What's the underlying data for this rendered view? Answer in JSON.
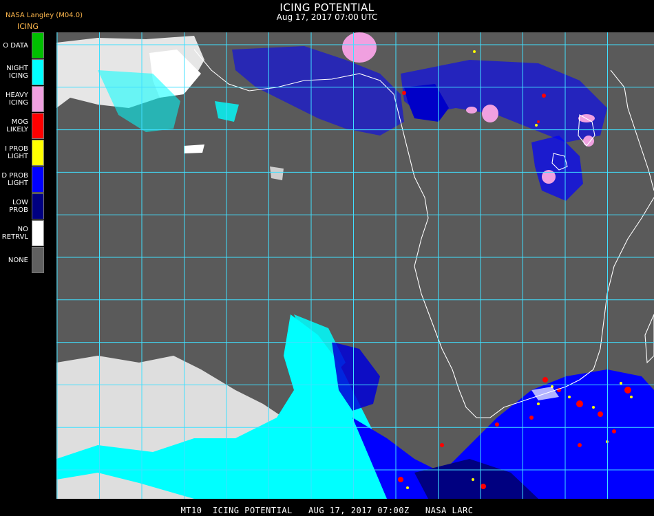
{
  "header": {
    "title": "ICING POTENTIAL",
    "datetime": "Aug 17, 2017 07:00 UTC"
  },
  "product_id": "NASA Langley (M04.0)",
  "legend": {
    "title": "ICING",
    "items": [
      {
        "label_lines": [
          "O DATA"
        ],
        "color": "#00c000"
      },
      {
        "label_lines": [
          "NIGHT",
          "ICING"
        ],
        "color": "#00ffff"
      },
      {
        "label_lines": [
          "HEAVY",
          "ICING"
        ],
        "color": "#f0a0e0"
      },
      {
        "label_lines": [
          "MOG",
          "LIKELY"
        ],
        "color": "#ff0000"
      },
      {
        "label_lines": [
          "I PROB",
          "LIGHT"
        ],
        "color": "#ffff00"
      },
      {
        "label_lines": [
          "D PROB",
          "LIGHT"
        ],
        "color": "#0000ff"
      },
      {
        "label_lines": [
          "LOW",
          "PROB"
        ],
        "color": "#000080"
      },
      {
        "label_lines": [
          "NO",
          "RETRVL"
        ],
        "color": "#ffffff"
      },
      {
        "label_lines": [
          "NONE"
        ],
        "color": "#606060"
      }
    ]
  },
  "map": {
    "background_color": "#5a5a5a",
    "grid_color": "#40e0ff",
    "coastline_color": "#ffffff",
    "gridline_count_vertical": 14,
    "gridline_count_horizontal": 11
  },
  "footer": {
    "text": "MT10  ICING POTENTIAL   AUG 17, 2017 07:00Z   NASA LARC"
  }
}
